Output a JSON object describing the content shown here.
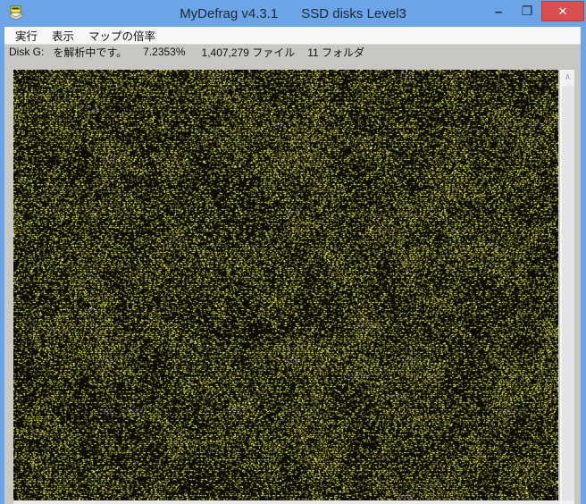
{
  "window": {
    "title_app": "MyDefrag v4.3.1",
    "title_script": "SSD disks Level3",
    "controls": {
      "minimize_glyph": "–",
      "maximize_glyph": "❐",
      "close_glyph": "✕"
    }
  },
  "menu": {
    "items": [
      {
        "label": "実行"
      },
      {
        "label": "表示"
      },
      {
        "label": "マップの倍率"
      }
    ]
  },
  "status": {
    "disk": "Disk G:",
    "message": "を解析中です。",
    "progress": "7.2353%",
    "files": "1,407,279 ファイル",
    "folders": "11 フォルダ"
  },
  "scrollbar": {
    "up_glyph": "∧"
  },
  "colors": {
    "titlebar": "#6ca4e8",
    "close_button": "#d8504e",
    "client_bg": "#c9c7c3",
    "menubar_bg": "#f7f7f7",
    "map_background": "#0c0c02",
    "map_dash_bright": "#ebeb55",
    "map_dash_dim": "#8d8d3a"
  }
}
